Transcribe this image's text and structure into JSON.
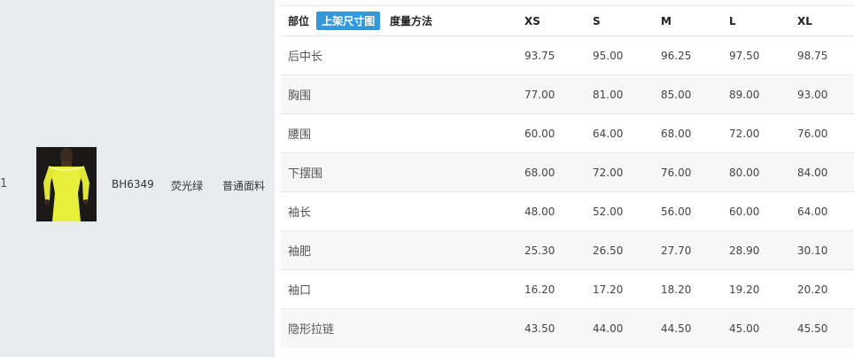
{
  "product_row": {
    "index": "1",
    "code": "BH6349",
    "color": "荧光绿",
    "fabric": "普通面料"
  },
  "table": {
    "header": {
      "part": "部位",
      "upload_button": "上架尺寸图",
      "method": "度量方法",
      "sizes": [
        "XS",
        "S",
        "M",
        "L",
        "XL"
      ]
    },
    "rows": [
      {
        "part": "后中长",
        "method": "",
        "values": [
          "93.75",
          "95.00",
          "96.25",
          "97.50",
          "98.75"
        ]
      },
      {
        "part": "胸围",
        "method": "",
        "values": [
          "77.00",
          "81.00",
          "85.00",
          "89.00",
          "93.00"
        ]
      },
      {
        "part": "腰围",
        "method": "",
        "values": [
          "60.00",
          "64.00",
          "68.00",
          "72.00",
          "76.00"
        ]
      },
      {
        "part": "下摆围",
        "method": "",
        "values": [
          "68.00",
          "72.00",
          "76.00",
          "80.00",
          "84.00"
        ]
      },
      {
        "part": "袖长",
        "method": "",
        "values": [
          "48.00",
          "52.00",
          "56.00",
          "60.00",
          "64.00"
        ]
      },
      {
        "part": "袖肥",
        "method": "",
        "values": [
          "25.30",
          "26.50",
          "27.70",
          "28.90",
          "30.10"
        ]
      },
      {
        "part": "袖口",
        "method": "",
        "values": [
          "16.20",
          "17.20",
          "18.20",
          "19.20",
          "20.20"
        ]
      },
      {
        "part": "隐形拉链",
        "method": "",
        "values": [
          "43.50",
          "44.00",
          "44.50",
          "45.00",
          "45.50"
        ]
      }
    ]
  },
  "colors": {
    "accent_button": "#3498db",
    "left_panel_bg": "#e9ecef",
    "stripe_row_bg": "#f7f7f7",
    "garment_color": "#e8ef3a"
  }
}
